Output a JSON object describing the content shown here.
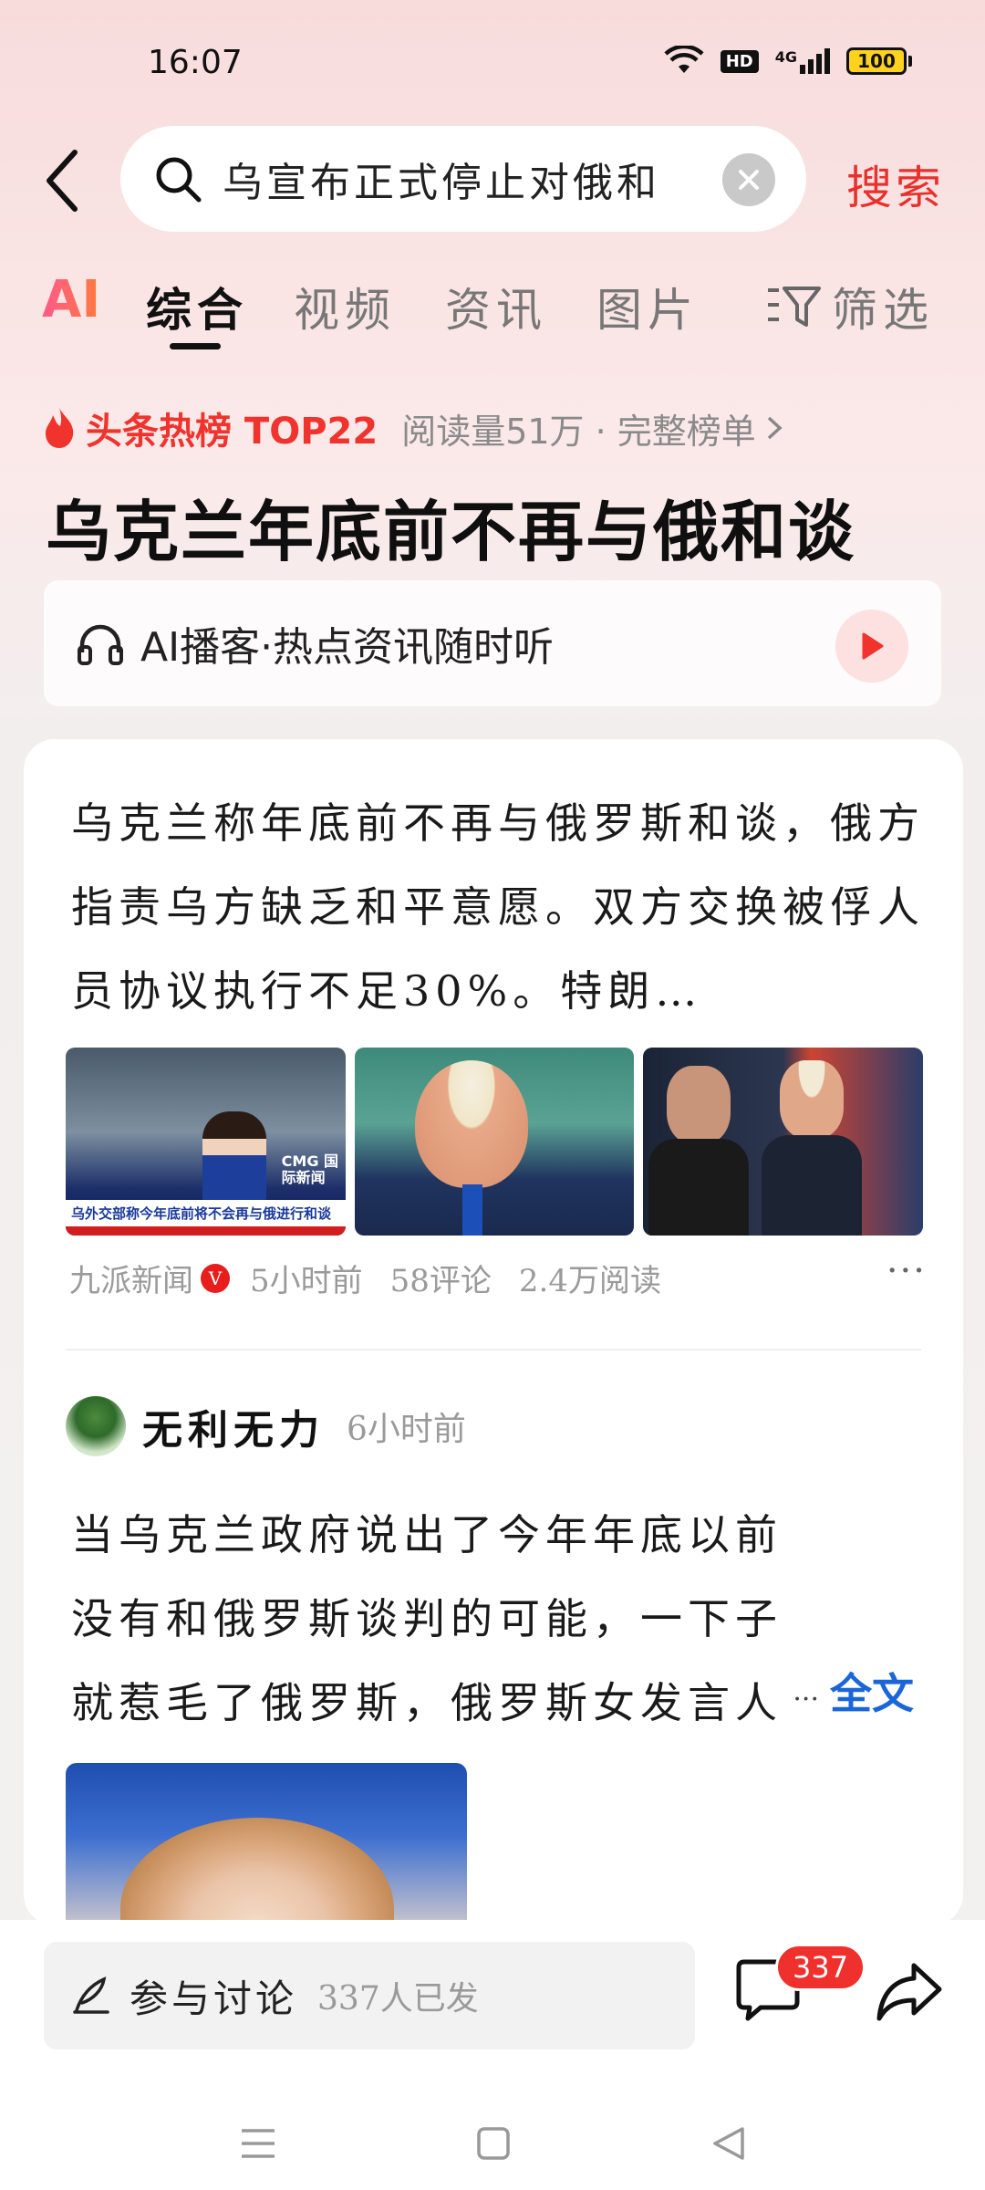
{
  "status_bar": {
    "time": "16:07",
    "hd_label": "HD",
    "network": "4G",
    "battery": "100",
    "icons": [
      "wifi-icon",
      "hd-icon",
      "signal-4g-icon",
      "battery-icon"
    ]
  },
  "search": {
    "query": "乌宣布正式停止对俄和",
    "action_label": "搜索",
    "icons": [
      "back-icon",
      "search-icon",
      "clear-icon"
    ]
  },
  "tabs": {
    "ai_label": "AI",
    "items": [
      "综合",
      "视频",
      "资讯",
      "图片"
    ],
    "active_index": 0,
    "filter_label": "筛选"
  },
  "hot_rank": {
    "title": "头条热榜 TOP22",
    "meta": "阅读量51万 · 完整榜单",
    "topic": "乌克兰年底前不再与俄和谈"
  },
  "podcast": {
    "label": "AI播客·热点资讯随时听"
  },
  "news_card": {
    "summary": "乌克兰称年底前不再与俄罗斯和谈，俄方指责乌方缺乏和平意愿。双方交换被俘人员协议执行不足30%。特朗…",
    "thumb_caption_1": "乌外交部称今年底前将不会再与俄进行和谈",
    "thumb_tag_1": "CMG 国际新闻",
    "source": "九派新闻",
    "time": "5小时前",
    "comments": "58评论",
    "reads": "2.4万阅读"
  },
  "post": {
    "author": "无利无力",
    "time": "6小时前",
    "text": "当乌克兰政府说出了今年年底以前没有和俄罗斯谈判的可能，一下子就惹毛了俄罗斯，俄罗斯女发言人",
    "more_label": "全文"
  },
  "bottom_bar": {
    "discuss_label": "参与讨论",
    "discuss_count": "337人已发",
    "comment_badge": "337"
  },
  "colors": {
    "accent_red": "#e8302c",
    "link_blue": "#1a66d8"
  }
}
